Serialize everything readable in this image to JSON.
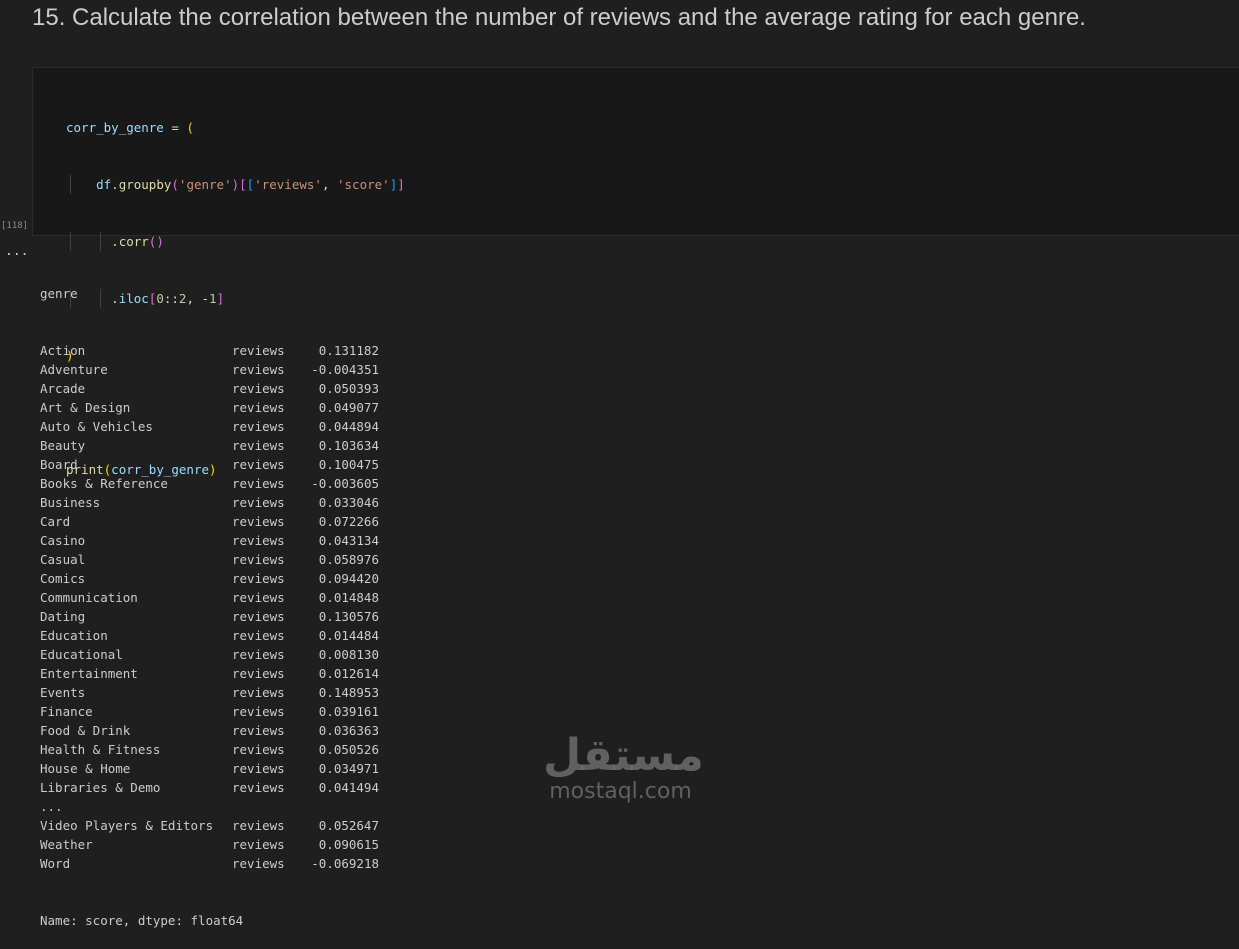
{
  "heading": "15. Calculate the correlation between the number of reviews and the average rating for each genre.",
  "code_cell": {
    "execution_count": "[118]",
    "lines": [
      "corr_by_genre = (",
      "    df.groupby('genre')[['reviews', 'score']]",
      "      .corr()",
      "      .iloc[0::2, -1]",
      ")",
      "",
      "print(corr_by_genre)"
    ]
  },
  "output": {
    "ellipsis": "...",
    "index_header": "genre",
    "rows": [
      {
        "genre": "Action",
        "var": "reviews",
        "value": "0.131182"
      },
      {
        "genre": "Adventure",
        "var": "reviews",
        "value": "-0.004351"
      },
      {
        "genre": "Arcade",
        "var": "reviews",
        "value": "0.050393"
      },
      {
        "genre": "Art & Design",
        "var": "reviews",
        "value": "0.049077"
      },
      {
        "genre": "Auto & Vehicles",
        "var": "reviews",
        "value": "0.044894"
      },
      {
        "genre": "Beauty",
        "var": "reviews",
        "value": "0.103634"
      },
      {
        "genre": "Board",
        "var": "reviews",
        "value": "0.100475"
      },
      {
        "genre": "Books & Reference",
        "var": "reviews",
        "value": "-0.003605"
      },
      {
        "genre": "Business",
        "var": "reviews",
        "value": "0.033046"
      },
      {
        "genre": "Card",
        "var": "reviews",
        "value": "0.072266"
      },
      {
        "genre": "Casino",
        "var": "reviews",
        "value": "0.043134"
      },
      {
        "genre": "Casual",
        "var": "reviews",
        "value": "0.058976"
      },
      {
        "genre": "Comics",
        "var": "reviews",
        "value": "0.094420"
      },
      {
        "genre": "Communication",
        "var": "reviews",
        "value": "0.014848"
      },
      {
        "genre": "Dating",
        "var": "reviews",
        "value": "0.130576"
      },
      {
        "genre": "Education",
        "var": "reviews",
        "value": "0.014484"
      },
      {
        "genre": "Educational",
        "var": "reviews",
        "value": "0.008130"
      },
      {
        "genre": "Entertainment",
        "var": "reviews",
        "value": "0.012614"
      },
      {
        "genre": "Events",
        "var": "reviews",
        "value": "0.148953"
      },
      {
        "genre": "Finance",
        "var": "reviews",
        "value": "0.039161"
      },
      {
        "genre": "Food & Drink",
        "var": "reviews",
        "value": "0.036363"
      },
      {
        "genre": "Health & Fitness",
        "var": "reviews",
        "value": "0.050526"
      },
      {
        "genre": "House & Home",
        "var": "reviews",
        "value": "0.034971"
      },
      {
        "genre": "Libraries & Demo",
        "var": "reviews",
        "value": "0.041494"
      },
      {
        "genre": "...",
        "var": "",
        "value": ""
      },
      {
        "genre": "Video Players & Editors",
        "var": "reviews",
        "value": "0.052647"
      },
      {
        "genre": "Weather",
        "var": "reviews",
        "value": "0.090615"
      },
      {
        "genre": "Word",
        "var": "reviews",
        "value": "-0.069218"
      }
    ],
    "footer": "Name: score, dtype: float64"
  },
  "watermark": {
    "arabic": "مستقل",
    "latin": "mostaql.com"
  }
}
